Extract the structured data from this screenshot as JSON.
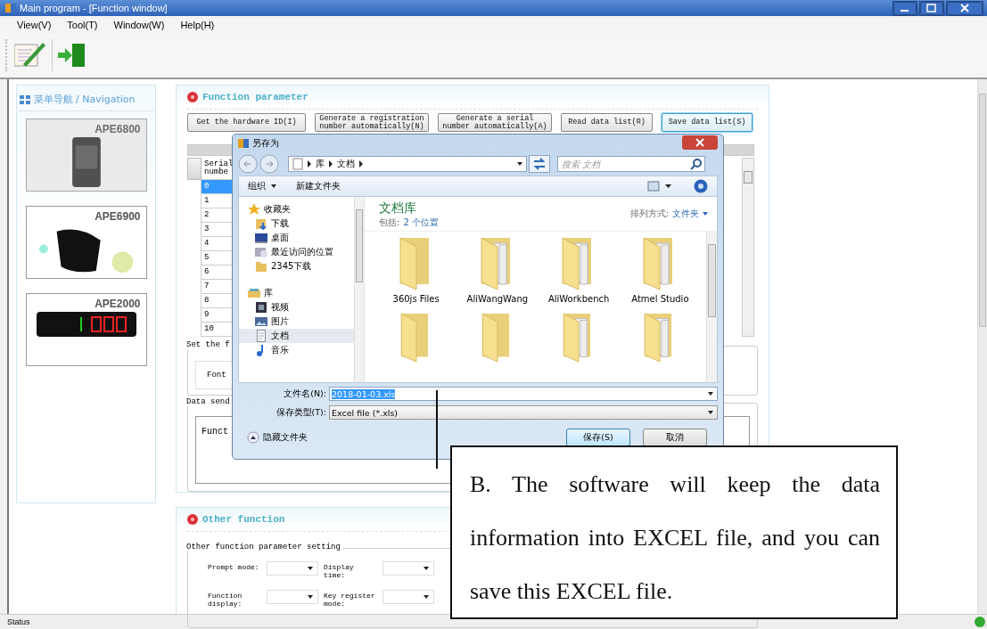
{
  "window": {
    "title": "Main program - [Function window]"
  },
  "menu": [
    "View(V)",
    "Tool(T)",
    "Window(W)",
    "Help(H)"
  ],
  "navigation": {
    "title": "菜单导航 / Navigation",
    "products": [
      {
        "label": "APE6800",
        "kind": "watch",
        "dimmed": true
      },
      {
        "label": "APE6900",
        "kind": "band",
        "dimmed": false
      },
      {
        "label": "APE2000",
        "kind": "display",
        "dimmed": false
      }
    ]
  },
  "function_parameter": {
    "title": "Function parameter",
    "buttons": [
      {
        "label": "Get the hardware ID(I)",
        "focused": false
      },
      {
        "label": "Generate a registration number automatically(N)",
        "focused": false
      },
      {
        "label": "Generate a serial number automatically(A)",
        "focused": false
      },
      {
        "label": "Read data list(R)",
        "focused": false
      },
      {
        "label": "Save data list(S)",
        "focused": true
      }
    ],
    "table": {
      "column": "Serial numbe",
      "rows": [
        {
          "cell": "0",
          "selected": true
        },
        {
          "cell": "1",
          "selected": false
        },
        {
          "cell": "2",
          "selected": false
        },
        {
          "cell": "3",
          "selected": false
        },
        {
          "cell": "4",
          "selected": false
        },
        {
          "cell": "5",
          "selected": false
        },
        {
          "cell": "6",
          "selected": false
        },
        {
          "cell": "7",
          "selected": false
        },
        {
          "cell": "8",
          "selected": false
        },
        {
          "cell": "9",
          "selected": false
        },
        {
          "cell": "10",
          "selected": false
        }
      ]
    },
    "font_group": {
      "legend": "Set the f",
      "label": "Font"
    },
    "data_group": {
      "legend": "Data send",
      "text": "Funct"
    }
  },
  "other_function": {
    "title": "Other function",
    "legend": "Other function parameter setting",
    "fields": [
      {
        "label": "Prompt mode:"
      },
      {
        "label": "Display time:"
      },
      {
        "label": "Function display:"
      },
      {
        "label": "Key register mode:"
      }
    ]
  },
  "status_bar": "Status",
  "dialog": {
    "title": "另存为",
    "path": [
      "库",
      "文档"
    ],
    "search": {
      "placeholder": "搜索 文档"
    },
    "commands": [
      {
        "label": "组织",
        "kind": "menu"
      },
      {
        "label": "新建文件夹",
        "kind": "plain"
      }
    ],
    "tree": [
      {
        "label": "收藏夹",
        "kind": "star",
        "selected": false,
        "children": [
          {
            "label": "下载",
            "kind": "download",
            "selected": false
          },
          {
            "label": "桌面",
            "kind": "desktop",
            "selected": false
          },
          {
            "label": "最近访问的位置",
            "kind": "recent",
            "selected": false
          },
          {
            "label": "2345下载",
            "kind": "folder",
            "selected": false
          }
        ]
      },
      {
        "label": "库",
        "kind": "library",
        "selected": false,
        "children": [
          {
            "label": "视频",
            "kind": "video",
            "selected": false
          },
          {
            "label": "图片",
            "kind": "picture",
            "selected": false
          },
          {
            "label": "文档",
            "kind": "document",
            "selected": true
          },
          {
            "label": "音乐",
            "kind": "music",
            "selected": false
          }
        ]
      }
    ],
    "library_title": "文档库",
    "includes_label": "包括:",
    "includes_link": "2 个位置",
    "arrange_label": "排列方式:",
    "arrange_value": "文件夹",
    "folders": [
      {
        "label": "360js Files",
        "kind": "plain"
      },
      {
        "label": "AliWangWang",
        "kind": "papers"
      },
      {
        "label": "AliWorkbench",
        "kind": "papers"
      },
      {
        "label": "Atmel Studio",
        "kind": "papers"
      },
      {
        "kind": "plain"
      },
      {
        "kind": "plain"
      },
      {
        "kind": "papers"
      },
      {
        "kind": "papers"
      }
    ],
    "filename": {
      "label": "文件名(N):",
      "value": "2018-01-03.xls"
    },
    "filetype": {
      "label": "保存类型(T):",
      "value": "Excel file (*.xls)"
    },
    "hide_folders": "隐藏文件夹",
    "buttons": [
      {
        "label": "保存(S)",
        "default": true
      },
      {
        "label": "取消",
        "default": false
      }
    ]
  },
  "callout": {
    "text": "B. The software will keep the data information into EXCEL file, and you can save this EXCEL file."
  }
}
